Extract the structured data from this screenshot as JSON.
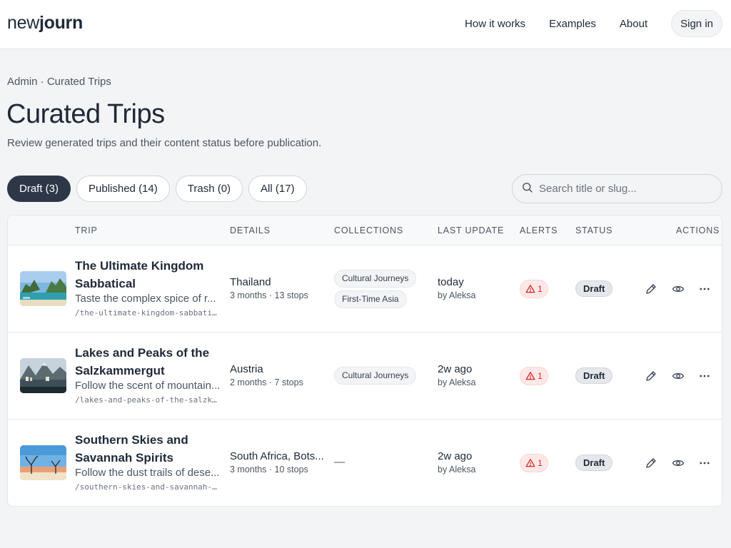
{
  "header": {
    "logo_light": "new",
    "logo_bold": "journ",
    "nav": [
      "How it works",
      "Examples",
      "About"
    ],
    "signin": "Sign in"
  },
  "page": {
    "breadcrumb": "Admin · Curated Trips",
    "title": "Curated Trips",
    "subtitle": "Review generated trips and their content status before publication."
  },
  "filters": [
    {
      "label": "Draft (3)",
      "active": true
    },
    {
      "label": "Published (14)",
      "active": false
    },
    {
      "label": "Trash (0)",
      "active": false
    },
    {
      "label": "All (17)",
      "active": false
    }
  ],
  "search": {
    "placeholder": "Search title or slug..."
  },
  "table": {
    "columns": [
      "TRIP",
      "DETAILS",
      "COLLECTIONS",
      "LAST UPDATE",
      "ALERTS",
      "STATUS",
      "ACTIONS"
    ],
    "rows": [
      {
        "title": "The Ultimate Kingdom Sabbatical",
        "description": "Taste the complex spice of r...",
        "slug": "/the-ultimate-kingdom-sabbati...",
        "country": "Thailand",
        "details": "3 months · 13 stops",
        "collections": [
          "Cultural Journeys",
          "First-Time Asia"
        ],
        "updated": "today",
        "updated_by": "by Aleksa",
        "alerts": "1",
        "status": "Draft",
        "thumb": "tropical-bay"
      },
      {
        "title": "Lakes and Peaks of the Salzkammergut",
        "description": "Follow the scent of mountain...",
        "slug": "/lakes-and-peaks-of-the-salzk...",
        "country": "Austria",
        "details": "2 months · 7 stops",
        "collections": [
          "Cultural Journeys"
        ],
        "updated": "2w ago",
        "updated_by": "by Aleksa",
        "alerts": "1",
        "status": "Draft",
        "thumb": "alpine-lake"
      },
      {
        "title": "Southern Skies and Savannah Spirits",
        "description": "Follow the dust trails of dese...",
        "slug": "/southern-skies-and-savannah-...",
        "country": "South Africa, Bots...",
        "details": "3 months · 10 stops",
        "collections": [],
        "collections_empty": "—",
        "updated": "2w ago",
        "updated_by": "by Aleksa",
        "alerts": "1",
        "status": "Draft",
        "thumb": "desert-trees"
      }
    ]
  },
  "icons": {
    "search": "search-icon",
    "alert": "warning-triangle-icon",
    "edit": "pencil-icon",
    "view": "eye-icon",
    "more": "more-horizontal-icon"
  },
  "colors": {
    "active_pill": "#2d3748",
    "alert_text": "#dc2626",
    "alert_bg": "#fde8e8"
  }
}
